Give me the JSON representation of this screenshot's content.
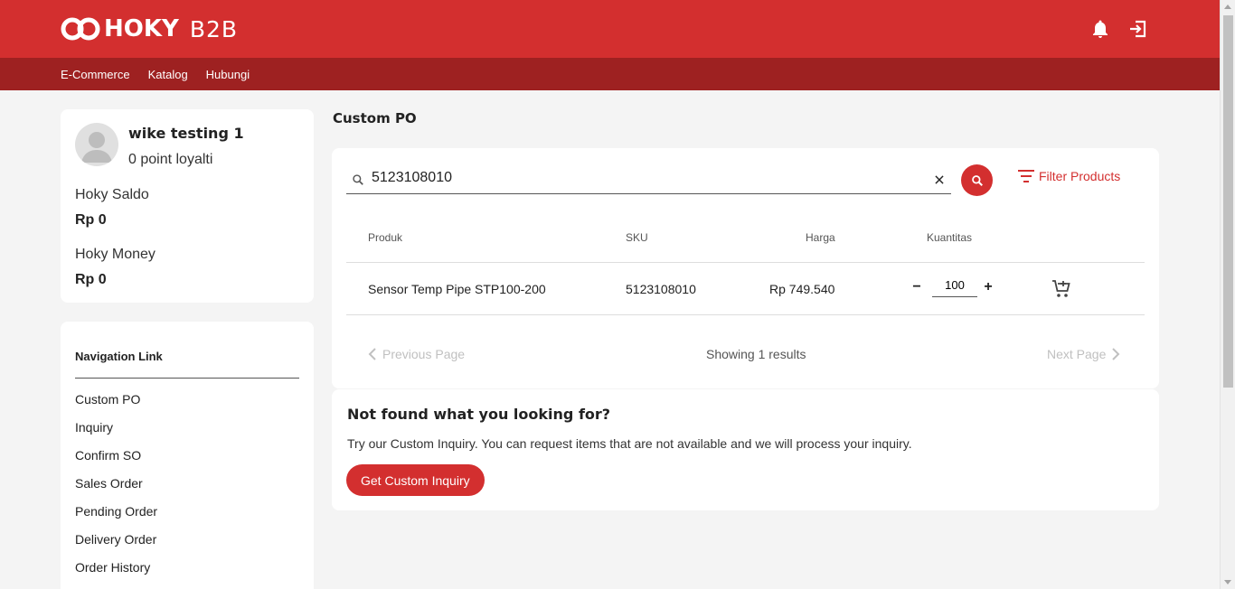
{
  "brand": {
    "name": "HOKY",
    "suffix": "B2B",
    "color": "#d32f2f",
    "dark": "#9e2121"
  },
  "header": {
    "icons": [
      "bell-icon",
      "logout-icon"
    ]
  },
  "subnav": {
    "items": [
      "E-Commerce",
      "Katalog",
      "Hubungi"
    ]
  },
  "profile": {
    "name": "wike testing 1",
    "points": "0 point loyalti",
    "saldo_label": "Hoky Saldo",
    "saldo_value": "Rp 0",
    "money_label": "Hoky Money",
    "money_value": "Rp 0"
  },
  "nav": {
    "title": "Navigation Link",
    "items": [
      "Custom PO",
      "Inquiry",
      "Confirm SO",
      "Sales Order",
      "Pending Order",
      "Delivery Order",
      "Order History"
    ]
  },
  "page": {
    "title": "Custom PO"
  },
  "search": {
    "value": "5123108010",
    "filter_label": "Filter Products"
  },
  "table": {
    "headers": {
      "product": "Produk",
      "sku": "SKU",
      "price": "Harga",
      "qty": "Kuantitas"
    },
    "rows": [
      {
        "product": "Sensor Temp Pipe STP100-200",
        "sku": "5123108010",
        "price": "Rp 749.540",
        "qty": "100"
      }
    ]
  },
  "pagination": {
    "prev": "Previous Page",
    "next": "Next Page",
    "showing": "Showing 1 results"
  },
  "inquiry": {
    "title": "Not found what you looking for?",
    "text": "Try our Custom Inquiry. You can request items that are not available and we will process your inquiry.",
    "button": "Get Custom Inquiry"
  }
}
